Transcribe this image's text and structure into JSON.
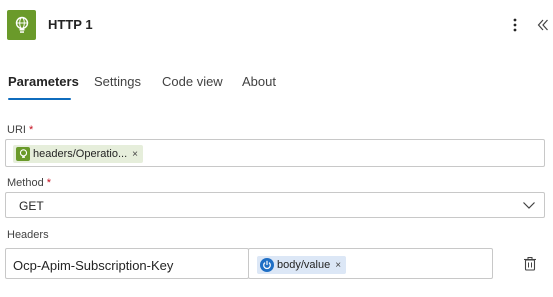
{
  "header": {
    "title": "HTTP 1",
    "icon": "globe-bulb-icon",
    "icon_color": "#6a9a2a",
    "more_icon": "more-vertical-icon",
    "collapse_icon": "double-chevron-left-icon"
  },
  "tabs": [
    {
      "label": "Parameters",
      "active": true
    },
    {
      "label": "Settings",
      "active": false
    },
    {
      "label": "Code view",
      "active": false
    },
    {
      "label": "About",
      "active": false
    }
  ],
  "fields": {
    "uri": {
      "label": "URI",
      "required_mark": "*",
      "token": {
        "text": "headers/Operatio...",
        "remove": "×",
        "icon": "globe-bulb-icon"
      }
    },
    "method": {
      "label": "Method",
      "required_mark": "*",
      "value": "GET",
      "icon": "chevron-down-icon"
    },
    "headers": {
      "label": "Headers",
      "rows": [
        {
          "key": "Ocp-Apim-Subscription-Key",
          "value_token": {
            "text": "body/value",
            "remove": "×",
            "icon": "power-icon"
          },
          "delete_icon": "delete-row-icon"
        }
      ]
    }
  },
  "colors": {
    "accent": "#0f6cbd",
    "required": "#c50f1f",
    "token_blue_bg": "#dce7f6",
    "token_green_bg": "#e6eedb"
  }
}
